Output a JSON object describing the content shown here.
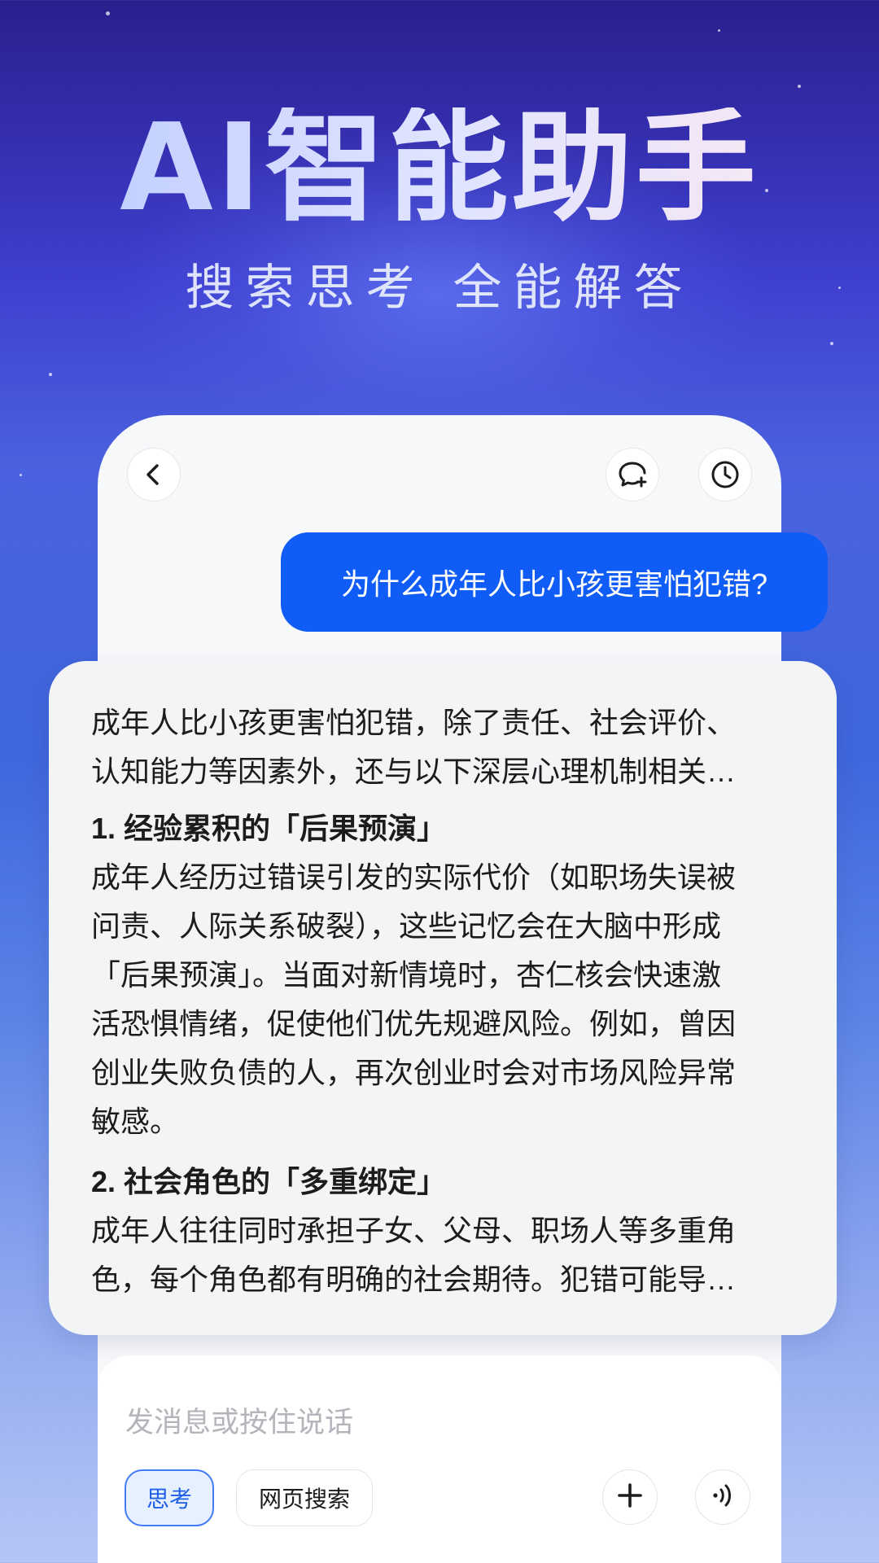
{
  "hero": {
    "title": "AI智能助手",
    "subtitle": "搜索思考 全能解答"
  },
  "chat_header": {
    "back_icon": "chevron-left-icon",
    "new_chat_icon": "chat-bubble-plus-icon",
    "history_icon": "clock-icon"
  },
  "user_message": "为什么成年人比小孩更害怕犯错?",
  "answer": {
    "intro_line1": "成年人比小孩更害怕犯错，除了责任、社会评价、",
    "intro_line2": "认知能力等因素外，还与以下深层心理机制相关…",
    "sections": [
      {
        "title": "1. 经验累积的「后果预演」",
        "lines": [
          "成年人经历过错误引发的实际代价（如职场失误被",
          "问责、人际关系破裂），这些记忆会在大脑中形成",
          "「后果预演」。当面对新情境时，杏仁核会快速激",
          "活恐惧情绪，促使他们优先规避风险。例如，曾因",
          "创业失败负债的人，再次创业时会对市场风险异常",
          "敏感。"
        ]
      },
      {
        "title": "2. 社会角色的「多重绑定」",
        "lines": [
          "成年人往往同时承担子女、父母、职场人等多重角",
          "色，每个角色都有明确的社会期待。犯错可能导…"
        ]
      }
    ]
  },
  "input": {
    "placeholder": "发消息或按住说话",
    "chip_think": "思考",
    "chip_web": "网页搜索",
    "add_icon": "plus-icon",
    "voice_icon": "voice-wave-icon"
  },
  "colors": {
    "accent": "#0f5cf6",
    "chip_active_bg": "#e6f0ff",
    "chip_active_text": "#1f5fe8"
  }
}
